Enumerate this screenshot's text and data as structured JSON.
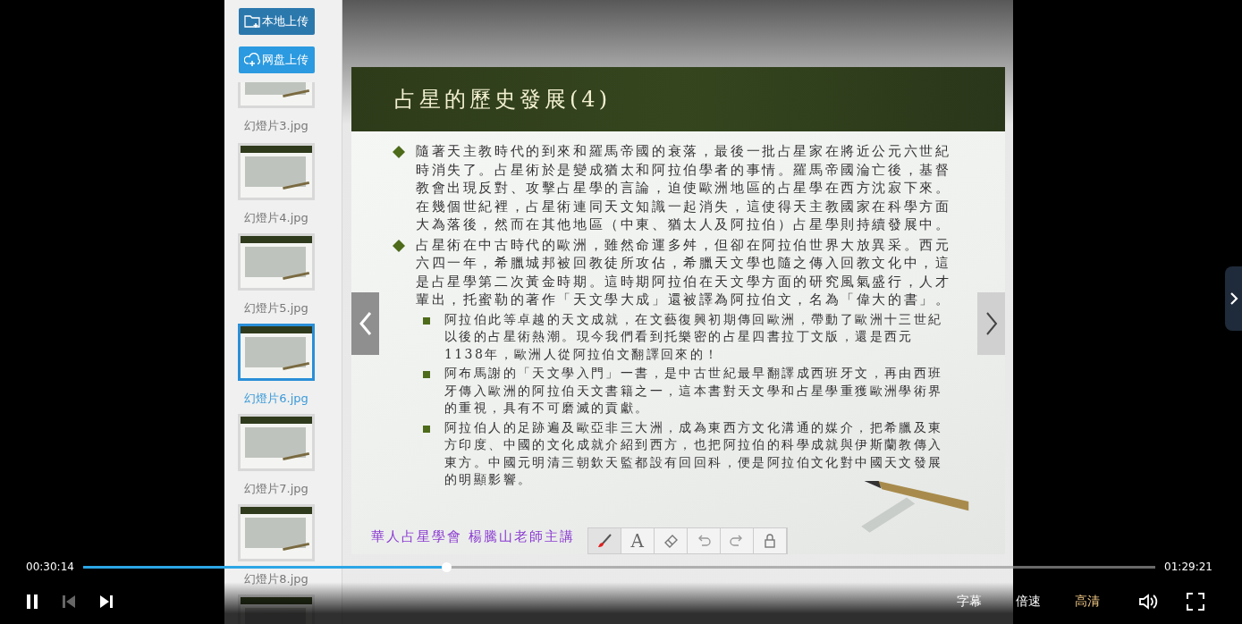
{
  "sidebar": {
    "upload_buttons": [
      {
        "label": "本地上传",
        "kind": "folder"
      },
      {
        "label": "网盘上传",
        "kind": "cloud"
      }
    ],
    "slides": [
      {
        "label": "幻燈片3.jpg",
        "selected": false
      },
      {
        "label": "幻燈片4.jpg",
        "selected": false
      },
      {
        "label": "幻燈片5.jpg",
        "selected": false
      },
      {
        "label": "幻燈片6.jpg",
        "selected": true
      },
      {
        "label": "幻燈片7.jpg",
        "selected": false
      },
      {
        "label": "幻燈片8.jpg",
        "selected": false
      },
      {
        "selected": false
      }
    ]
  },
  "slide": {
    "title": "占星的歷史發展(4)",
    "points": [
      {
        "kind": "main",
        "text": "隨著天主教時代的到來和羅馬帝國的衰落，最後一批占星家在將近公元六世紀時消失了。占星術於是變成猶太和阿拉伯學者的事情。羅馬帝國淪亡後，基督教會出現反對、攻擊占星學的言論，迫使歐洲地區的占星學在西方沈寂下來。在幾個世紀裡，占星術連同天文知識一起消失，這使得天主教國家在科學方面大為落後，然而在其他地區（中東、猶太人及阿拉伯）占星學則持續發展中。"
      },
      {
        "kind": "main",
        "text": "占星術在中古時代的歐洲，雖然命運多舛，但卻在阿拉伯世界大放異采。西元六四一年，希臘城邦被回教徒所攻佔，希臘天文學也隨之傳入回教文化中，這是占星學第二次黃金時期。這時期阿拉伯在天文學方面的研究風氣盛行，人才輩出，托蜜勒的著作「天文學大成」還被譯為阿拉伯文，名為「偉大的書」。"
      },
      {
        "kind": "sub",
        "text": "阿拉伯此等卓越的天文成就，在文藝復興初期傳回歐洲，帶動了歐洲十三世紀以後的占星術熱潮。現今我們看到托樂密的占星四書拉丁文版，還是西元1138年，歐洲人從阿拉伯文翻譯回來的！"
      },
      {
        "kind": "sub",
        "text": "阿布馬謝的「天文學入門」一書，是中古世紀最早翻譯成西班牙文，再由西班牙傳入歐洲的阿拉伯天文書籍之一，這本書對天文學和占星學重獲歐洲學術界的重視，具有不可磨滅的貢獻。"
      },
      {
        "kind": "sub",
        "text": "阿拉伯人的足跡遍及歐亞非三大洲，成為東西方文化溝通的媒介，把希臘及東方印度、中國的文化成就介紹到西方，也把阿拉伯的科學成就與伊斯蘭教傳入東方。中國元明清三朝欽天監都設有回回科，便是阿拉伯文化對中國天文發展的明顯影響。"
      }
    ],
    "footer": "華人占星學會 楊騰山老師主講",
    "tools": [
      {
        "kind": "brush",
        "selected": true
      },
      {
        "kind": "text",
        "label": "A",
        "selected": false
      },
      {
        "kind": "eraser",
        "selected": false
      },
      {
        "kind": "undo",
        "selected": false
      },
      {
        "kind": "redo",
        "selected": false
      },
      {
        "kind": "lock",
        "selected": false
      }
    ]
  },
  "player": {
    "elapsed": "00:30:14",
    "duration": "01:29:21",
    "level": 0.339,
    "playing": true,
    "previous_disabled": true,
    "options": [
      {
        "label": "字幕",
        "selected": false
      },
      {
        "label": "倍速",
        "selected": false
      },
      {
        "label": "高清",
        "selected": true
      }
    ]
  }
}
